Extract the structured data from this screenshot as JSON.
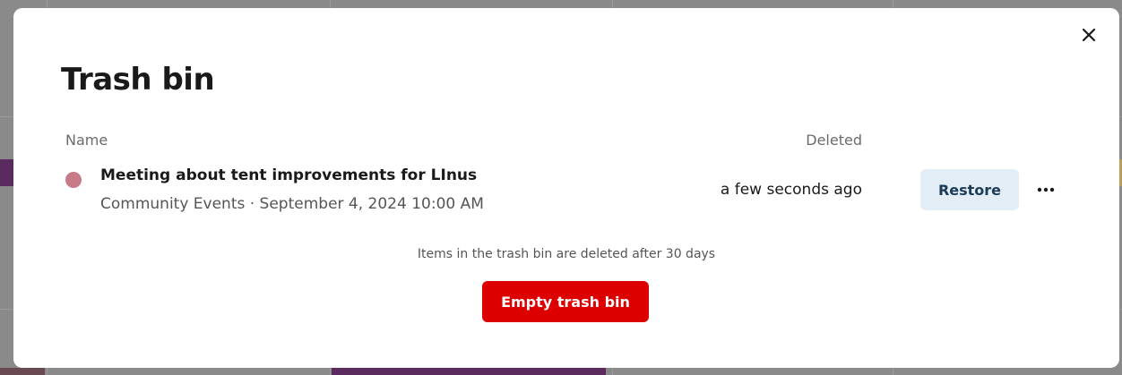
{
  "dialog": {
    "title": "Trash bin",
    "close_icon": "close-icon",
    "columns": {
      "name": "Name",
      "deleted": "Deleted"
    },
    "items": [
      {
        "title": "Meeting about tent improvements for LInus",
        "subtitle": "Community Events · September 4, 2024 10:00 AM",
        "deleted": "a few seconds ago",
        "color": "#c97a89",
        "restore_label": "Restore",
        "more_icon": "more-horizontal-icon"
      }
    ],
    "footnote": "Items in the trash bin are deleted after 30 days",
    "empty_button_label": "Empty trash bin"
  },
  "colors": {
    "overlay": "#8a8a8a",
    "restore_bg": "#e3edf6",
    "restore_text": "#1c3b57",
    "danger": "#dd0000",
    "background_event_purple": "#5b2a5f",
    "background_event_yellow": "#b8a05a"
  }
}
